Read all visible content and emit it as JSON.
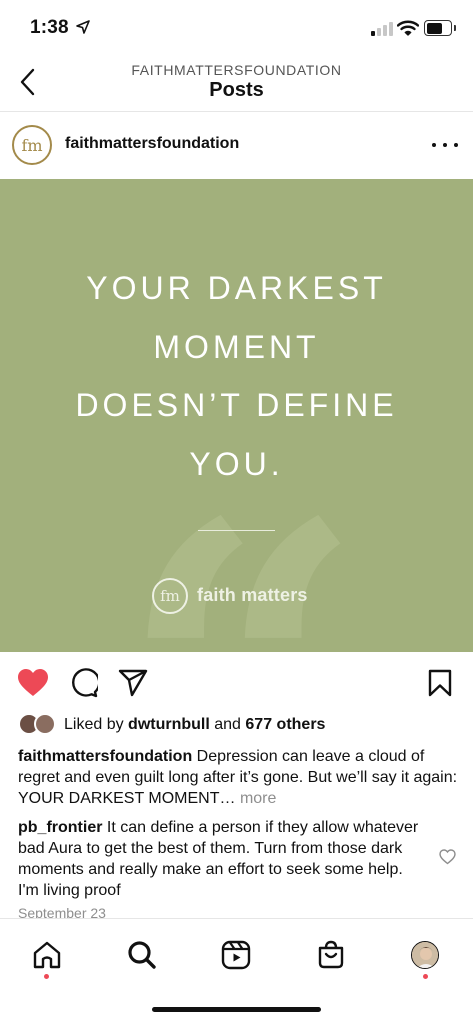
{
  "status_bar": {
    "time": "1:38",
    "icons": [
      "location-arrow-icon",
      "cellular-signal-icon",
      "wifi-icon",
      "battery-icon"
    ]
  },
  "nav": {
    "username": "FAITHMATTERSFOUNDATION",
    "title": "Posts",
    "back_icon": "chevron-left-icon"
  },
  "post": {
    "username": "faithmattersfoundation",
    "avatar_monogram": "fm",
    "image": {
      "quote_lines": [
        "YOUR DARKEST",
        "MOMENT",
        "DOESN’T DEFINE",
        "YOU."
      ],
      "brand_monogram": "fm",
      "brand_name": "faith matters",
      "background_color": "#a2b07c"
    },
    "actions": [
      "heart-icon",
      "comment-icon",
      "share-icon",
      "bookmark-icon"
    ],
    "liked": true,
    "likes": {
      "prefix": "Liked by ",
      "user": "dwturnbull",
      "middle": " and ",
      "others": "677 others"
    },
    "caption": {
      "username": "faithmattersfoundation",
      "text": " Depression can leave a cloud of regret and even guilt long after it’s gone. But we’ll say it again: YOUR DARKEST MOMENT…",
      "more": " more"
    },
    "comment": {
      "username": "pb_frontier",
      "text": " It can define a person if they allow whatever bad Aura to get the best of them. Turn from those dark moments and really make an effort to seek some help. I'm living proof"
    },
    "date": "September 23"
  },
  "tab_bar": {
    "items": [
      "home-icon",
      "search-icon",
      "reels-icon",
      "shop-icon",
      "profile-avatar"
    ]
  },
  "colors": {
    "like_red": "#ed4956",
    "image_green": "#a2b07c",
    "brand_gold": "#a38a4a"
  }
}
